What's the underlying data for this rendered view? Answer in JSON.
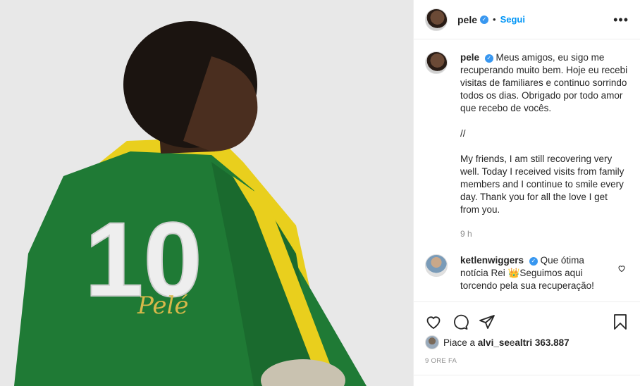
{
  "post": {
    "username": "pele",
    "follow_label": "Segui",
    "dot": "•",
    "more_label": "•••",
    "verified_mark": "✓"
  },
  "caption": {
    "username": "pele",
    "paragraph_pt": "Meus amigos, eu sigo me recuperando muito bem. Hoje eu recebi visitas de familiares e continuo sorrindo todos os dias. Obrigado por todo amor que recebo de vocês.",
    "separator": "//",
    "paragraph_en": "My friends, I am still recovering very well. Today I received visits from family members and I continue to smile every day. Thank you for all the love I get from you.",
    "time": "9 h"
  },
  "comment": {
    "username": "ketlenwiggers",
    "text": "Que ótima notícia Rei 👑Seguimos aqui torcendo pela sua recuperação!"
  },
  "likes": {
    "prefix": "Piace a ",
    "user": "alvi_se",
    "middle": " e ",
    "rest": "altri 363.887"
  },
  "posted_ago": "9 ORE FA",
  "photo": {
    "jersey_number": "10",
    "signature": "Pelé",
    "colors": {
      "green": "#1f7a35",
      "yellow": "#f1d21b",
      "background": "#e9e9e9"
    }
  }
}
